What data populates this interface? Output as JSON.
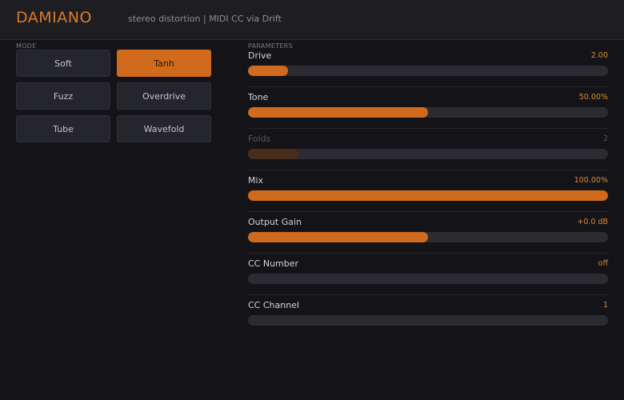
{
  "header": {
    "title": "DAMIANO",
    "subtitle": "stereo distortion  |  MIDI CC via Drift"
  },
  "colors": {
    "accent": "#d06b1d",
    "accent_dim": "#4a2c1a",
    "title": "#dc7a2a",
    "value_text": "#d88a3a"
  },
  "mode": {
    "label": "MODE",
    "selected": "Tanh",
    "buttons": [
      {
        "label": "Soft"
      },
      {
        "label": "Tanh"
      },
      {
        "label": "Fuzz"
      },
      {
        "label": "Overdrive"
      },
      {
        "label": "Tube"
      },
      {
        "label": "Wavefold"
      }
    ]
  },
  "parameters": {
    "label": "PARAMETERS",
    "items": [
      {
        "name": "Drive",
        "value": "2.00",
        "level": 0.11,
        "enabled": true
      },
      {
        "name": "Tone",
        "value": "50.00%",
        "level": 0.5,
        "enabled": true
      },
      {
        "name": "Folds",
        "value": "2",
        "level": 0.14,
        "enabled": false
      },
      {
        "name": "Mix",
        "value": "100.00%",
        "level": 1.0,
        "enabled": true
      },
      {
        "name": "Output Gain",
        "value": "+0.0 dB",
        "level": 0.5,
        "enabled": true
      },
      {
        "name": "CC Number",
        "value": "off",
        "level": 0.0,
        "enabled": true
      },
      {
        "name": "CC Channel",
        "value": "1",
        "level": 0.0,
        "enabled": true
      }
    ]
  }
}
